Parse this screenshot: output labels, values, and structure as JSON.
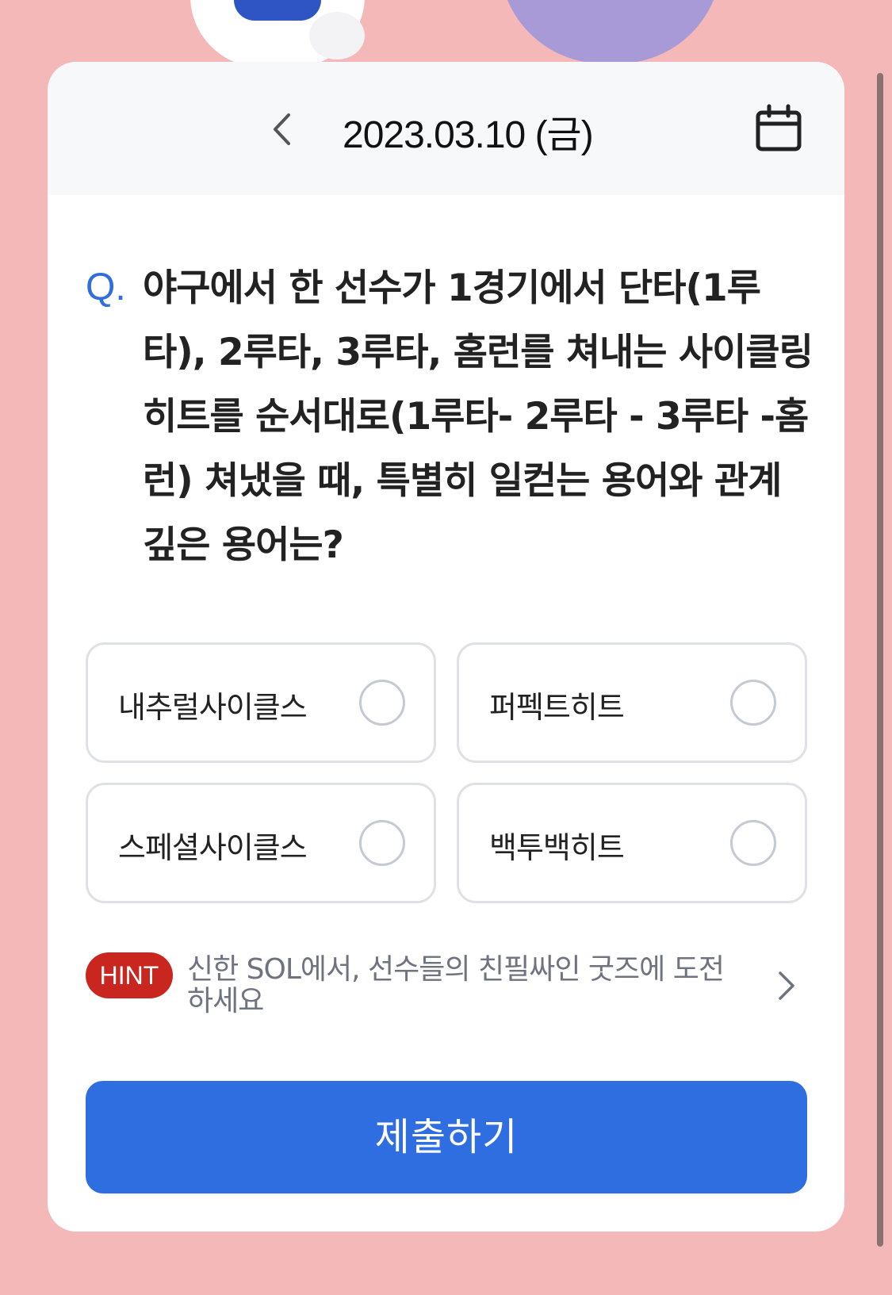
{
  "header": {
    "date": "2023.03.10 (금)",
    "prev_icon": "chevron-left-icon",
    "calendar_icon": "calendar-icon"
  },
  "question": {
    "marker": "Q.",
    "text": "야구에서 한 선수가 1경기에서 단타(1루타), 2루타, 3루타, 홈런를 쳐내는 사이클링 히트를 순서대로(1루타- 2루타 - 3루타 -홈런) 쳐냈을 때, 특별히 일컫는 용어와 관계 깊은 용어는?"
  },
  "options": [
    {
      "label": "내추럴사이클스",
      "selected": false
    },
    {
      "label": "퍼펙트히트",
      "selected": false
    },
    {
      "label": "스페셜사이클스",
      "selected": false
    },
    {
      "label": "백투백히트",
      "selected": false
    }
  ],
  "hint": {
    "badge": "HINT",
    "text": "신한 SOL에서, 선수들의 친필싸인 굿즈에 도전하세요",
    "arrow_icon": "chevron-right-icon"
  },
  "submit_label": "제출하기",
  "colors": {
    "background": "#f4b8b8",
    "accent": "#2e6ee0",
    "hint_badge": "#c8261f",
    "q_marker": "#2f6fdd"
  }
}
